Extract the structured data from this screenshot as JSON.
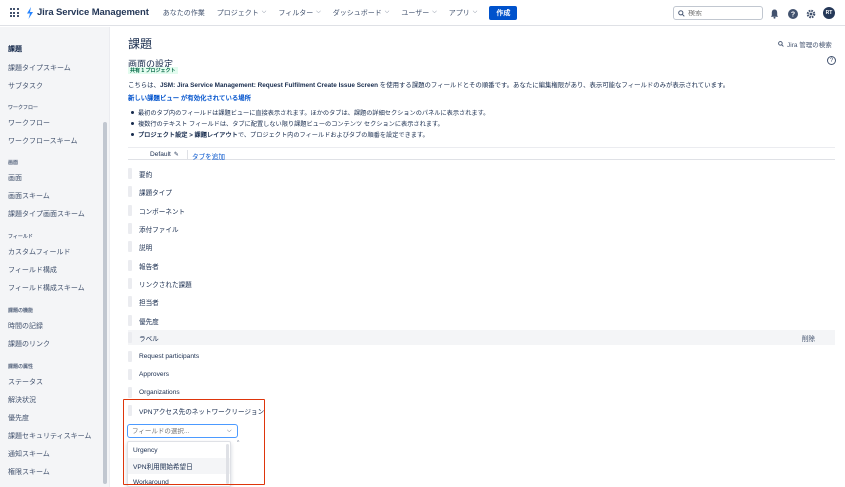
{
  "topnav": {
    "product": "Jira Service Management",
    "items": [
      "あなたの作業",
      "プロジェクト",
      "フィルター",
      "ダッシュボード",
      "ユーザー",
      "アプリ"
    ],
    "create_label": "作成",
    "search_placeholder": "検索",
    "avatar_initials": "RT"
  },
  "sidebar": {
    "title": "課題",
    "items_top": [
      "課題タイプスキーム",
      "サブタスク"
    ],
    "sections": [
      {
        "label": "ワークフロー",
        "items": [
          "ワークフロー",
          "ワークフロースキーム"
        ]
      },
      {
        "label": "画面",
        "items": [
          "画面",
          "画面スキーム",
          "課題タイプ画面スキーム"
        ]
      },
      {
        "label": "フィールド",
        "items": [
          "カスタムフィールド",
          "フィールド構成",
          "フィールド構成スキーム"
        ]
      },
      {
        "label": "課題の機能",
        "items": [
          "時間の記録",
          "課題のリンク"
        ]
      },
      {
        "label": "課題の属性",
        "items": [
          "ステータス",
          "解決状況",
          "優先度",
          "課題セキュリティスキーム",
          "通知スキーム",
          "権限スキーム"
        ]
      }
    ]
  },
  "main": {
    "page_title": "課題",
    "jira_admin_search": "Jira 管理の検索",
    "section_title": "画面の設定",
    "shared_badge": "共有 1 プロジェクト",
    "desc_prefix": "こちらは、",
    "desc_screen": "JSM: Jira Service Management: Request Fulfilment Create Issue Screen",
    "desc_suffix": " を使用する課題のフィールドとその順番です。あなたに編集権限があり、表示可能なフィールドのみが表示されています。",
    "new_view_link": "新しい課題ビュー が有効化されている場所",
    "bullets": [
      "最初のタブ内のフィールドは課題ビューに直接表示されます。ほかのタブは、課題の詳細セクションのパネルに表示されます。",
      "複数行のテキスト フィールドは、タブに配置しない限り課題ビューのコンテンツ セクションに表示されます。"
    ],
    "bullet3_bold": "プロジェクト設定 > 課題レイアウト",
    "bullet3_rest": " で、プロジェクト内のフィールドおよびタブの順番を設定できます。",
    "tab_default": "Default",
    "tab_add": "タブを追加",
    "fields": [
      "要約",
      "課題タイプ",
      "コンポーネント",
      "添付ファイル",
      "説明",
      "報告者",
      "リンクされた課題",
      "担当者",
      "優先度",
      "ラベル",
      "Request participants",
      "Approvers",
      "Organizations",
      "VPNアクセス先のネットワークリージョン"
    ],
    "remove_label": "削除",
    "select_placeholder": "フィールドの選択...",
    "dropdown_options": [
      "Urgency",
      "VPN利用開始希望日",
      "Workaround"
    ]
  },
  "colors": {
    "brand": "#0052cc",
    "highlight": "#de350b"
  }
}
